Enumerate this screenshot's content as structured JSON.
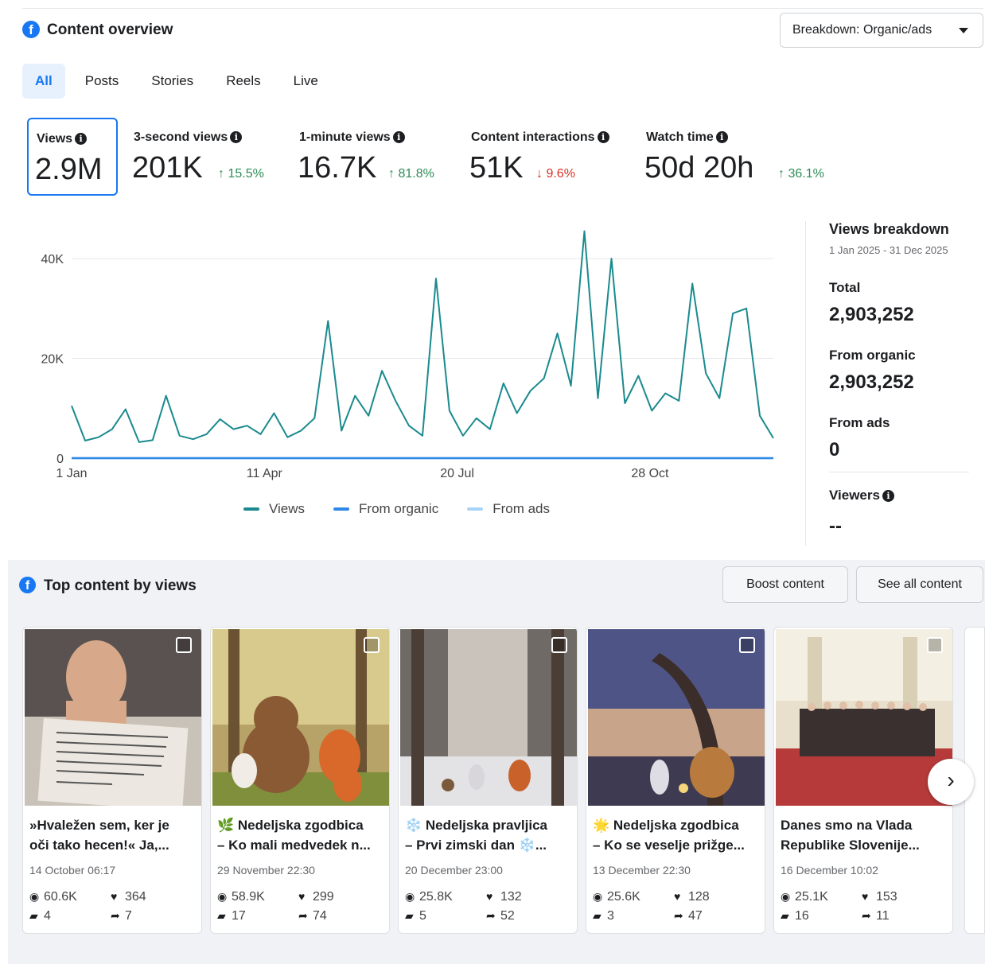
{
  "header": {
    "title": "Content overview",
    "breakdown_label": "Breakdown: Organic/ads"
  },
  "tabs": [
    {
      "label": "All",
      "active": true
    },
    {
      "label": "Posts",
      "active": false
    },
    {
      "label": "Stories",
      "active": false
    },
    {
      "label": "Reels",
      "active": false
    },
    {
      "label": "Live",
      "active": false
    }
  ],
  "metrics": [
    {
      "label": "Views",
      "value": "2.9M",
      "delta": "",
      "direction": "",
      "selected": true
    },
    {
      "label": "3-second views",
      "value": "201K",
      "delta": "↑ 15.5%",
      "direction": "up",
      "selected": false
    },
    {
      "label": "1-minute views",
      "value": "16.7K",
      "delta": "↑ 81.8%",
      "direction": "up",
      "selected": false
    },
    {
      "label": "Content interactions",
      "value": "51K",
      "delta": "↓ 9.6%",
      "direction": "down",
      "selected": false
    },
    {
      "label": "Watch time",
      "value": "50d 20h",
      "delta": "↑ 36.1%",
      "direction": "up",
      "selected": false
    }
  ],
  "chart_data": {
    "type": "line",
    "title": "",
    "xlabel": "",
    "ylabel": "",
    "x_ticks": [
      "1 Jan",
      "11 Apr",
      "20 Jul",
      "28 Oct"
    ],
    "y_ticks": [
      "0",
      "20K",
      "40K"
    ],
    "ylim": [
      0,
      44000
    ],
    "x": [
      "2025-01-01",
      "2025-01-08",
      "2025-01-15",
      "2025-01-22",
      "2025-01-29",
      "2025-02-05",
      "2025-02-12",
      "2025-02-19",
      "2025-02-26",
      "2025-03-05",
      "2025-03-12",
      "2025-03-19",
      "2025-03-26",
      "2025-04-02",
      "2025-04-09",
      "2025-04-16",
      "2025-04-23",
      "2025-04-30",
      "2025-05-07",
      "2025-05-14",
      "2025-05-21",
      "2025-05-28",
      "2025-06-04",
      "2025-06-11",
      "2025-06-18",
      "2025-06-25",
      "2025-07-02",
      "2025-07-09",
      "2025-07-16",
      "2025-07-23",
      "2025-07-30",
      "2025-08-06",
      "2025-08-13",
      "2025-08-20",
      "2025-08-27",
      "2025-09-03",
      "2025-09-10",
      "2025-09-17",
      "2025-09-24",
      "2025-10-01",
      "2025-10-08",
      "2025-10-15",
      "2025-10-22",
      "2025-10-29",
      "2025-11-05",
      "2025-11-12",
      "2025-11-19",
      "2025-11-26",
      "2025-12-03",
      "2025-12-10",
      "2025-12-17",
      "2025-12-24",
      "2025-12-31"
    ],
    "series": [
      {
        "name": "Views",
        "color": "#1a8a8e",
        "values": [
          10500,
          3500,
          4200,
          5800,
          9800,
          3200,
          3600,
          12500,
          4500,
          3800,
          4800,
          7800,
          5800,
          6500,
          4800,
          9000,
          4200,
          5500,
          8000,
          27500,
          5500,
          12500,
          8500,
          17500,
          11500,
          6500,
          4500,
          36000,
          9500,
          4500,
          8000,
          5800,
          15000,
          9000,
          13500,
          16000,
          25000,
          14500,
          45500,
          12000,
          40000,
          11000,
          16500,
          9500,
          13000,
          11500,
          35000,
          17000,
          12000,
          29000,
          30000,
          8500,
          4000
        ]
      },
      {
        "name": "From organic",
        "color": "#2e89e6",
        "values": [
          0,
          0,
          0,
          0,
          0,
          0,
          0,
          0,
          0,
          0,
          0,
          0,
          0,
          0,
          0,
          0,
          0,
          0,
          0,
          0,
          0,
          0,
          0,
          0,
          0,
          0,
          0,
          0,
          0,
          0,
          0,
          0,
          0,
          0,
          0,
          0,
          0,
          0,
          0,
          0,
          0,
          0,
          0,
          0,
          0,
          0,
          0,
          0,
          0,
          0,
          0,
          0,
          0
        ]
      },
      {
        "name": "From ads",
        "color": "#a9d3f5",
        "values": [
          0,
          0,
          0,
          0,
          0,
          0,
          0,
          0,
          0,
          0,
          0,
          0,
          0,
          0,
          0,
          0,
          0,
          0,
          0,
          0,
          0,
          0,
          0,
          0,
          0,
          0,
          0,
          0,
          0,
          0,
          0,
          0,
          0,
          0,
          0,
          0,
          0,
          0,
          0,
          0,
          0,
          0,
          0,
          0,
          0,
          0,
          0,
          0,
          0,
          0,
          0,
          0,
          0
        ]
      }
    ],
    "grid": true,
    "legend": "bottom"
  },
  "breakdown": {
    "title": "Views breakdown",
    "date_range": "1 Jan 2025 - 31 Dec 2025",
    "total_label": "Total",
    "total_value": "2,903,252",
    "organic_label": "From organic",
    "organic_value": "2,903,252",
    "ads_label": "From ads",
    "ads_value": "0",
    "viewers_label": "Viewers",
    "viewers_value": "--"
  },
  "top_content": {
    "title": "Top content by views",
    "boost_label": "Boost content",
    "see_all_label": "See all content",
    "cards": [
      {
        "line1": "»Hvaležen sem, ker je",
        "line2": "oči tako hecen!« Ja,...",
        "date": "14 October 06:17",
        "views": "60.6K",
        "likes": "364",
        "comments": "4",
        "shares": "7"
      },
      {
        "line1": "🌿 Nedeljska zgodbica",
        "line2": "– Ko mali medvedek n...",
        "date": "29 November 22:30",
        "views": "58.9K",
        "likes": "299",
        "comments": "17",
        "shares": "74"
      },
      {
        "line1": "❄️ Nedeljska pravljica",
        "line2": "– Prvi zimski dan ❄️...",
        "date": "20 December 23:00",
        "views": "25.8K",
        "likes": "132",
        "comments": "5",
        "shares": "52"
      },
      {
        "line1": "🌟 Nedeljska zgodbica",
        "line2": "– Ko se veselje prižge...",
        "date": "13 December 22:30",
        "views": "25.6K",
        "likes": "128",
        "comments": "3",
        "shares": "47"
      },
      {
        "line1": "Danes smo na Vlada",
        "line2": "Republike Slovenije...",
        "date": "16 December 10:02",
        "views": "25.1K",
        "likes": "153",
        "comments": "16",
        "shares": "11"
      }
    ]
  },
  "colors": {
    "accent": "#1877f2",
    "views_line": "#1a8a8e",
    "organic_line": "#2e89e6",
    "ads_line": "#a9d3f5",
    "up": "#2e8b57",
    "down": "#d93025"
  }
}
